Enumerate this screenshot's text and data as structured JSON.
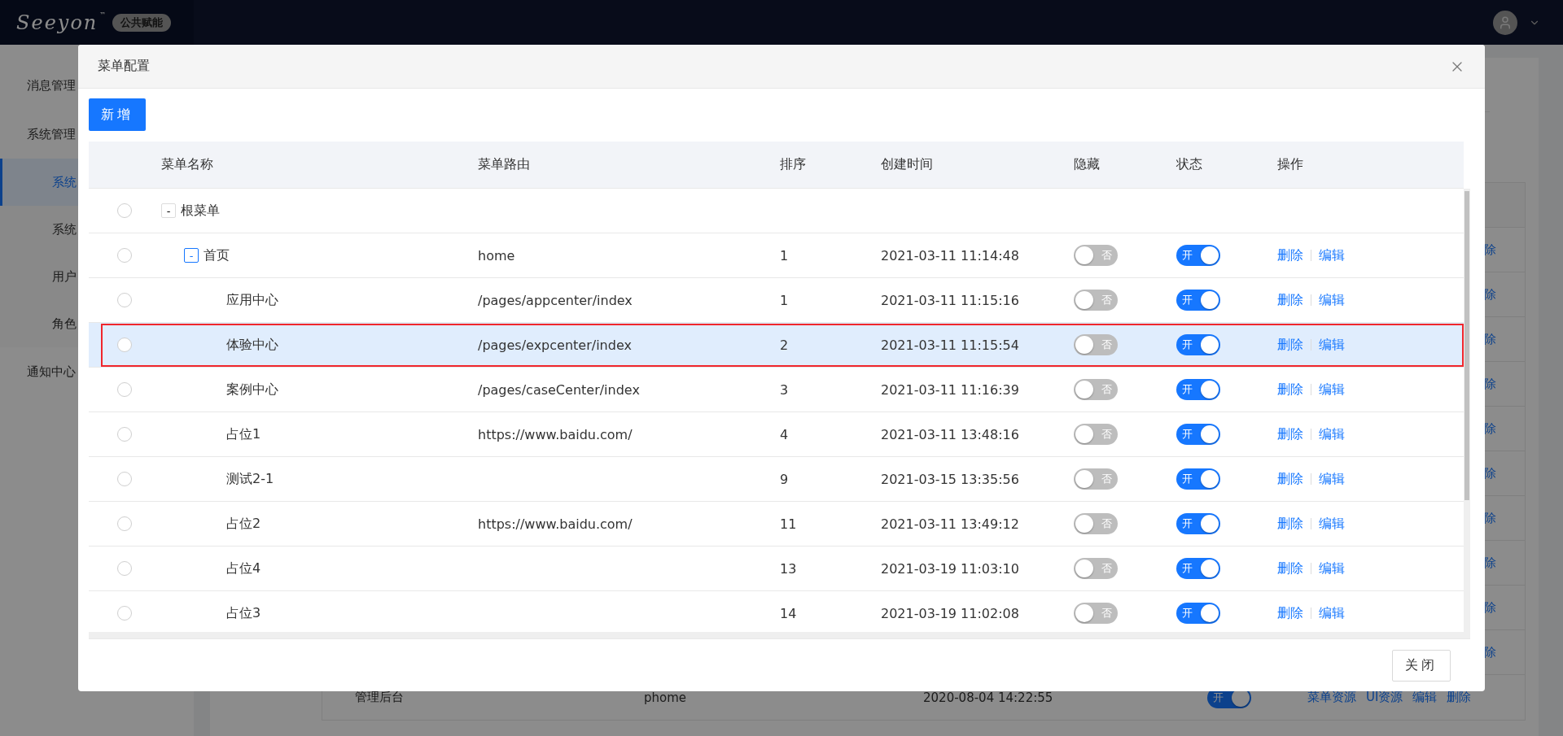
{
  "header": {
    "logo": "Seeyon",
    "logo_mark": "™",
    "badge": "公共赋能"
  },
  "sidebar": {
    "items": [
      {
        "label": "消息管理",
        "kind": "group",
        "selected": false
      },
      {
        "label": "系统管理",
        "kind": "group",
        "selected": false
      },
      {
        "label": "系统",
        "kind": "sub",
        "selected": true
      },
      {
        "label": "系统",
        "kind": "sub",
        "selected": false
      },
      {
        "label": "用户",
        "kind": "sub",
        "selected": false
      },
      {
        "label": "角色",
        "kind": "sub",
        "selected": false
      },
      {
        "label": "通知中心",
        "kind": "group",
        "selected": false
      }
    ]
  },
  "background_table": {
    "cut_rows": [
      "除",
      "除",
      "除",
      "除",
      "除",
      "除",
      "除",
      "除",
      "除",
      "除"
    ],
    "last_row": {
      "name": "管理后台",
      "route": "phome",
      "created": "2020-08-04 14:22:55",
      "status": {
        "on": true,
        "label": "开"
      },
      "actions": [
        "菜单资源",
        "UI资源",
        "编辑",
        "删除"
      ]
    }
  },
  "dialog": {
    "title": "菜单配置",
    "add_button": "新增",
    "close_button": "关闭",
    "columns": [
      "菜单名称",
      "菜单路由",
      "排序",
      "创建时间",
      "隐藏",
      "状态",
      "操作"
    ],
    "tree": [
      {
        "name": "根菜单",
        "selected": false,
        "outlined": false,
        "expander": {
          "glyph": "-",
          "focused": false
        },
        "children": [
          {
            "name": "首页",
            "route": "home",
            "order": "1",
            "created": "2021-03-11 11:14:48",
            "hidden": {
              "on": false,
              "label": "否"
            },
            "status": {
              "on": true,
              "label": "开"
            },
            "actions": [
              "删除",
              "编辑"
            ],
            "selected": false,
            "outlined": false,
            "expander": {
              "glyph": "-",
              "focused": true
            },
            "children": [
              {
                "name": "应用中心",
                "route": "/pages/appcenter/index",
                "order": "1",
                "created": "2021-03-11 11:15:16",
                "hidden": {
                  "on": false,
                  "label": "否"
                },
                "status": {
                  "on": true,
                  "label": "开"
                },
                "actions": [
                  "删除",
                  "编辑"
                ],
                "selected": false,
                "outlined": false
              },
              {
                "name": "体验中心",
                "route": "/pages/expcenter/index",
                "order": "2",
                "created": "2021-03-11 11:15:54",
                "hidden": {
                  "on": false,
                  "label": "否"
                },
                "status": {
                  "on": true,
                  "label": "开"
                },
                "actions": [
                  "删除",
                  "编辑"
                ],
                "selected": true,
                "outlined": true
              },
              {
                "name": "案例中心",
                "route": "/pages/caseCenter/index",
                "order": "3",
                "created": "2021-03-11 11:16:39",
                "hidden": {
                  "on": false,
                  "label": "否"
                },
                "status": {
                  "on": true,
                  "label": "开"
                },
                "actions": [
                  "删除",
                  "编辑"
                ],
                "selected": false,
                "outlined": false
              },
              {
                "name": "占位1",
                "route": "https://www.baidu.com/",
                "order": "4",
                "created": "2021-03-11 13:48:16",
                "hidden": {
                  "on": false,
                  "label": "否"
                },
                "status": {
                  "on": true,
                  "label": "开"
                },
                "actions": [
                  "删除",
                  "编辑"
                ],
                "selected": false,
                "outlined": false
              },
              {
                "name": "测试2-1",
                "order": "9",
                "created": "2021-03-15 13:35:56",
                "hidden": {
                  "on": false,
                  "label": "否"
                },
                "status": {
                  "on": true,
                  "label": "开"
                },
                "actions": [
                  "删除",
                  "编辑"
                ],
                "selected": false,
                "outlined": false
              },
              {
                "name": "占位2",
                "route": "https://www.baidu.com/",
                "order": "11",
                "created": "2021-03-11 13:49:12",
                "hidden": {
                  "on": false,
                  "label": "否"
                },
                "status": {
                  "on": true,
                  "label": "开"
                },
                "actions": [
                  "删除",
                  "编辑"
                ],
                "selected": false,
                "outlined": false
              },
              {
                "name": "占位4",
                "order": "13",
                "created": "2021-03-19 11:03:10",
                "hidden": {
                  "on": false,
                  "label": "否"
                },
                "status": {
                  "on": true,
                  "label": "开"
                },
                "actions": [
                  "删除",
                  "编辑"
                ],
                "selected": false,
                "outlined": false
              },
              {
                "name": "占位3",
                "order": "14",
                "created": "2021-03-19 11:02:08",
                "hidden": {
                  "on": false,
                  "label": "否"
                },
                "status": {
                  "on": true,
                  "label": "开"
                },
                "actions": [
                  "删除",
                  "编辑"
                ],
                "selected": false,
                "outlined": false
              }
            ]
          }
        ]
      }
    ]
  }
}
